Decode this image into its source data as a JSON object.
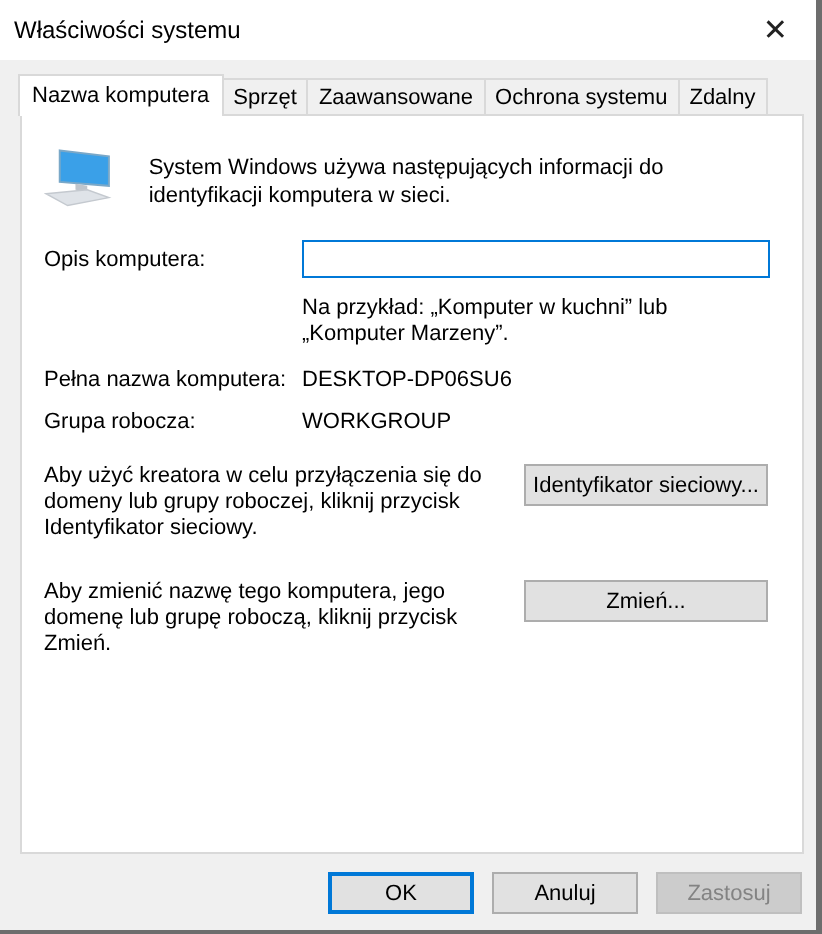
{
  "window": {
    "title": "Właściwości systemu",
    "close": "✕"
  },
  "tabs": [
    {
      "label": "Nazwa komputera",
      "selected": true
    },
    {
      "label": "Sprzęt",
      "selected": false
    },
    {
      "label": "Zaawansowane",
      "selected": false
    },
    {
      "label": "Ochrona systemu",
      "selected": false
    },
    {
      "label": "Zdalny",
      "selected": false
    }
  ],
  "intro": "System Windows używa następujących informacji do identyfikacji komputera w sieci.",
  "description": {
    "label": "Opis komputera:"
  },
  "hint": "Na przykład: „Komputer w kuchni” lub „Komputer Marzeny”.",
  "info": [
    {
      "label": "Pełna nazwa komputera:",
      "value": "DESKTOP-DP06SU6"
    },
    {
      "label": "Grupa robocza:",
      "value": "WORKGROUP"
    }
  ],
  "actions": [
    {
      "text": "Aby użyć kreatora w celu przyłączenia się do domeny lub grupy roboczej, kliknij przycisk Identyfikator sieciowy.",
      "button": "Identyfikator sieciowy..."
    },
    {
      "text": "Aby zmienić nazwę tego komputera, jego domenę lub grupę roboczą, kliknij przycisk Zmień.",
      "button": "Zmień..."
    }
  ],
  "buttons": [
    {
      "label": "OK",
      "default": true,
      "disabled": false
    },
    {
      "label": "Anuluj",
      "default": false,
      "disabled": false
    },
    {
      "label": "Zastosuj",
      "default": false,
      "disabled": true
    }
  ]
}
